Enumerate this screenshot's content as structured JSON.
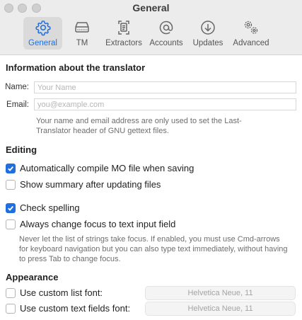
{
  "window": {
    "title": "General"
  },
  "toolbar": {
    "items": [
      {
        "label": "General",
        "icon": "gear-icon",
        "active": true
      },
      {
        "label": "TM",
        "icon": "database-drive-icon",
        "active": false
      },
      {
        "label": "Extractors",
        "icon": "extractor-icon",
        "active": false
      },
      {
        "label": "Accounts",
        "icon": "at-sign-icon",
        "active": false
      },
      {
        "label": "Updates",
        "icon": "download-arrow-icon",
        "active": false
      },
      {
        "label": "Advanced",
        "icon": "gears-icon",
        "active": false
      }
    ]
  },
  "translator": {
    "title": "Information about the translator",
    "name_label": "Name:",
    "name_placeholder": "Your Name",
    "name_value": "",
    "email_label": "Email:",
    "email_placeholder": "you@example.com",
    "email_value": "",
    "help": "Your name and email address are only used to set the Last-Translator header of GNU gettext files."
  },
  "editing": {
    "title": "Editing",
    "compile_mo": {
      "label": "Automatically compile MO file when saving",
      "checked": true
    },
    "show_summary": {
      "label": "Show summary after updating files",
      "checked": false
    },
    "check_spelling": {
      "label": "Check spelling",
      "checked": true
    },
    "change_focus": {
      "label": "Always change focus to text input field",
      "checked": false
    },
    "focus_help": "Never let the list of strings take focus. If enabled, you must use Cmd-arrows for keyboard navigation but you can also type text immediately, without having to press Tab to change focus."
  },
  "appearance": {
    "title": "Appearance",
    "list_font": {
      "label": "Use custom list font:",
      "checked": false,
      "font": "Helvetica Neue, 11"
    },
    "text_font": {
      "label": "Use custom text fields font:",
      "checked": false,
      "font": "Helvetica Neue, 11"
    }
  },
  "colors": {
    "accent": "#1f6fe0",
    "toolbar_bg": "#ececec",
    "active_tab_bg": "#dadada"
  }
}
